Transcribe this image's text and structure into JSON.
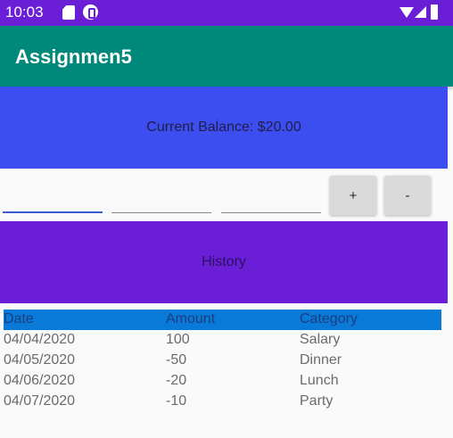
{
  "status_bar": {
    "time": "10:03"
  },
  "app_bar": {
    "title": "Assignmen5"
  },
  "balance": {
    "text": "Current Balance: $20.00"
  },
  "entry": {
    "field1_value": "",
    "field2_value": "",
    "field3_value": "",
    "plus_label": "+",
    "minus_label": "-"
  },
  "history": {
    "title": "History"
  },
  "table": {
    "headers": {
      "date": "Date",
      "amount": "Amount",
      "category": "Category"
    },
    "rows": [
      {
        "date": "04/04/2020",
        "amount": "100",
        "category": "Salary"
      },
      {
        "date": "04/05/2020",
        "amount": "-50",
        "category": "Dinner"
      },
      {
        "date": "04/06/2020",
        "amount": "-20",
        "category": "Lunch"
      },
      {
        "date": "04/07/2020",
        "amount": "-10",
        "category": "Party"
      }
    ]
  },
  "colors": {
    "status_bar": "#6a1fd6",
    "app_bar": "#00897b",
    "balance_panel": "#3d4ef0",
    "history_panel": "#6a1fd6",
    "table_header": "#0a7ad8"
  }
}
